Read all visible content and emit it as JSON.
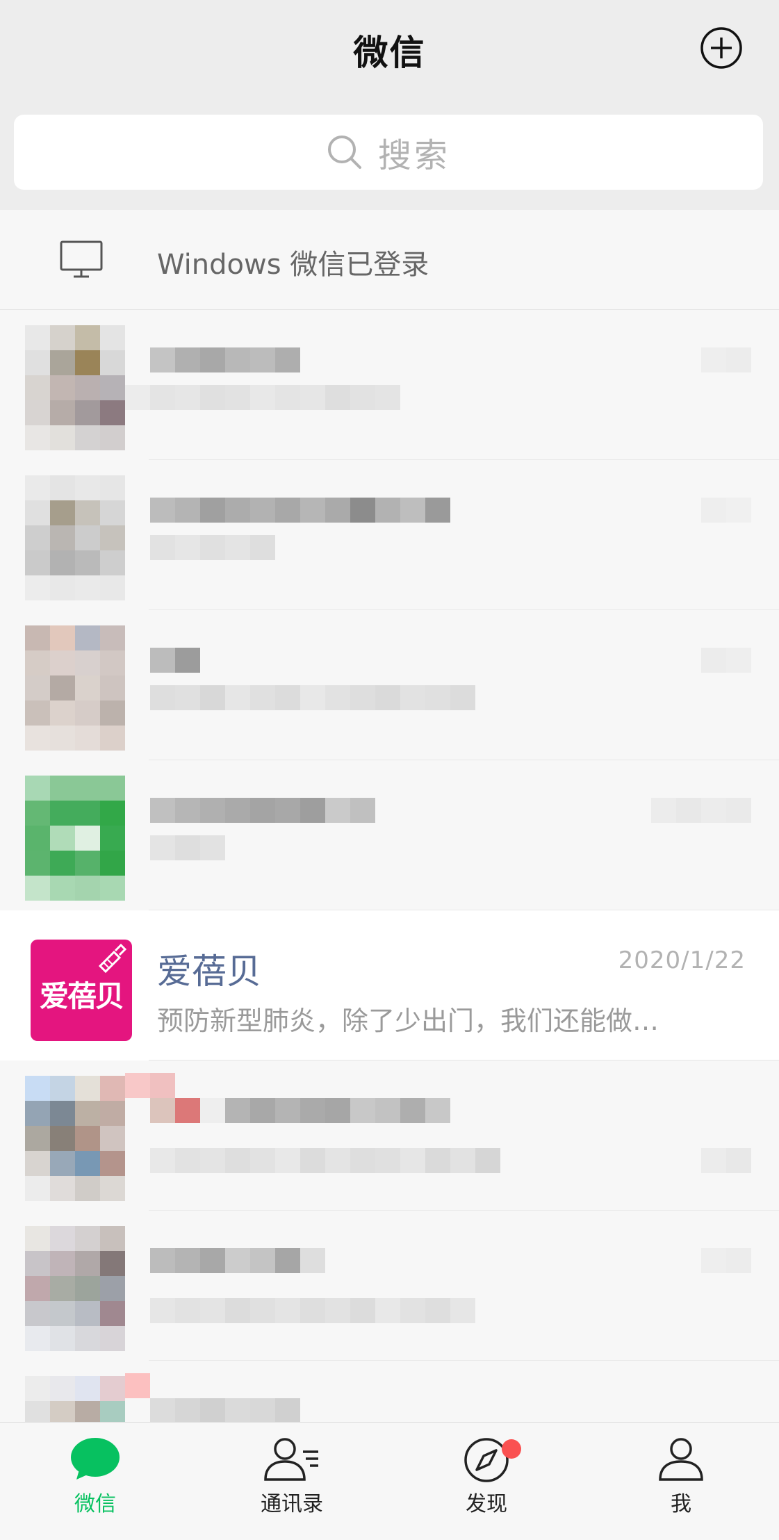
{
  "header": {
    "title": "微信"
  },
  "search": {
    "placeholder": "搜索"
  },
  "login_notice": {
    "text": "Windows 微信已登录"
  },
  "chat": {
    "name": "爱蓓贝",
    "avatar_text": "爱蓓贝",
    "time": "2020/1/22",
    "message": "预防新型肺炎，除了少出门，我们还能做…"
  },
  "tabs": [
    {
      "label": "微信",
      "icon": "chat-bubble-icon"
    },
    {
      "label": "通讯录",
      "icon": "contacts-icon"
    },
    {
      "label": "发现",
      "icon": "compass-icon"
    },
    {
      "label": "我",
      "icon": "person-icon"
    }
  ],
  "colors": {
    "accent": "#07c160",
    "name": "#576b95",
    "badge": "#fa5151",
    "brand": "#e4157f"
  }
}
